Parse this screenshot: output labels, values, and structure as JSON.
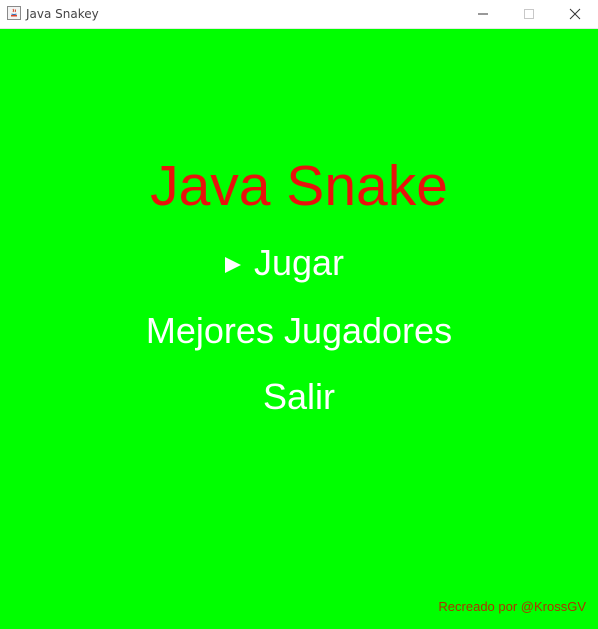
{
  "window": {
    "title": "Java Snakey"
  },
  "game": {
    "title": "Java Snake",
    "menu": {
      "selected": "Jugar",
      "items": [
        {
          "label": "Jugar"
        },
        {
          "label": "Mejores Jugadores"
        },
        {
          "label": "Salir"
        }
      ]
    },
    "credit": "Recreado por @KrossGV"
  },
  "colors": {
    "background": "#00ff00",
    "title": "#e8120c",
    "menu_text": "#ffffff",
    "credit": "#b03000"
  },
  "icons": {
    "app": "java-coffee-cup-icon",
    "cursor": "triangle-right-icon",
    "minimize": "minimize-icon",
    "maximize": "maximize-icon",
    "close": "close-icon"
  }
}
